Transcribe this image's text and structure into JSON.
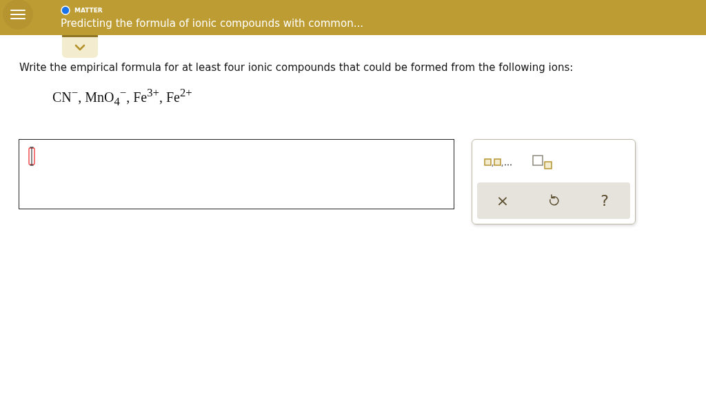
{
  "header": {
    "category": "MATTER",
    "title": "Predicting the formula of ionic compounds with common..."
  },
  "question": {
    "prompt": "Write the empirical formula for at least four ionic compounds that could be formed from the following ions:",
    "ions": "CN$^{−}$, MnO$_{4}$$^{−}$, Fe$^{3+}$, Fe$^{2+}$"
  },
  "templates": [
    {
      "kind": "list"
    },
    {
      "kind": "subscript"
    }
  ],
  "actions": [
    {
      "kind": "clear",
      "label": "×"
    },
    {
      "kind": "undo"
    },
    {
      "kind": "help",
      "label": "?"
    }
  ]
}
